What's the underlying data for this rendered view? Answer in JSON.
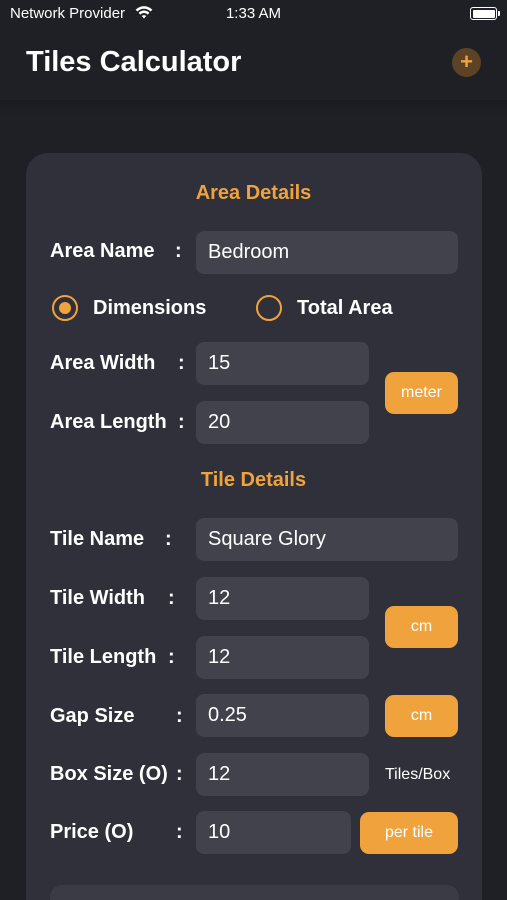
{
  "status": {
    "carrier": "Network Provider",
    "time": "1:33 AM"
  },
  "nav": {
    "title": "Tiles Calculator",
    "add_label": "+"
  },
  "area": {
    "section_title": "Area Details",
    "name_label": "Area Name",
    "name_value": "Bedroom",
    "mode_options": [
      "Dimensions",
      "Total Area"
    ],
    "selected_mode": "Dimensions",
    "width_label": "Area Width",
    "width_value": "15",
    "length_label": "Area Length",
    "length_value": "20",
    "unit": "meter"
  },
  "tile": {
    "section_title": "Tile Details",
    "name_label": "Tile Name",
    "name_value": "Square Glory",
    "width_label": "Tile Width",
    "width_value": "12",
    "length_label": "Tile Length",
    "length_value": "12",
    "size_unit": "cm",
    "gap_label": "Gap Size",
    "gap_value": "0.25",
    "gap_unit": "cm",
    "box_label": "Box Size (O)",
    "box_value": "12",
    "box_unit": "Tiles/Box",
    "price_label": "Price (O)",
    "price_value": "10",
    "price_unit": "per tile"
  },
  "colon": ":",
  "colors": {
    "background": "#1f2025",
    "card": "#2f3039",
    "field": "#41424c",
    "accent": "#f0a33c"
  }
}
